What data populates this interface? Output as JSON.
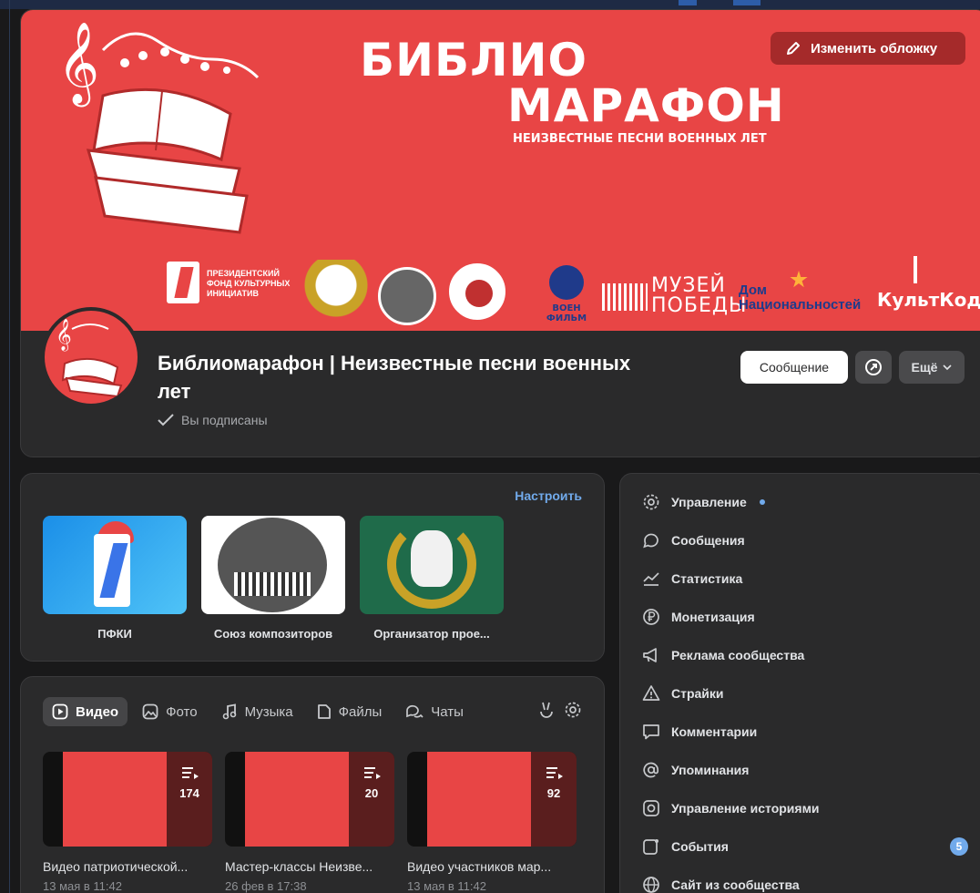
{
  "cover": {
    "title_line1": "БИБЛИО",
    "title_line2": "МАРАФОН",
    "subtitle": "НЕИЗВЕСТНЫЕ ПЕСНИ ВОЕННЫХ ЛЕТ",
    "edit_button": "Изменить обложку",
    "logos": {
      "pfki_text": "ПРЕЗИДЕНТСКИЙ ФОНД КУЛЬТУРНЫХ ИНИЦИАТИВ",
      "voen_text": "ВОЕН ФИЛЬМ",
      "muzey_text": "МУЗЕЙ ПОБЕДЫ",
      "dom_text": "Дом Национальностей",
      "kult_text": "КультКод"
    },
    "background_color": "#e84545"
  },
  "header": {
    "group_name": "Библиомарафон | Неизвестные песни военных лет",
    "subscribed_label": "Вы подписаны",
    "message_button": "Сообщение",
    "more_button": "Ещё"
  },
  "links": {
    "configure_label": "Настроить",
    "items": [
      {
        "label": "ПФКИ"
      },
      {
        "label": "Союз композиторов"
      },
      {
        "label": "Организатор прое..."
      }
    ]
  },
  "media": {
    "tabs": [
      {
        "label": "Видео",
        "icon": "video-icon",
        "active": true
      },
      {
        "label": "Фото",
        "icon": "photo-icon",
        "active": false
      },
      {
        "label": "Музыка",
        "icon": "music-icon",
        "active": false
      },
      {
        "label": "Файлы",
        "icon": "file-icon",
        "active": false
      },
      {
        "label": "Чаты",
        "icon": "chats-icon",
        "active": false
      }
    ],
    "videos": [
      {
        "count": "174",
        "title": "Видео патриотической...",
        "date": "13 мая в 11:42"
      },
      {
        "count": "20",
        "title": "Мастер-классы Неизве...",
        "date": "26 фев в 17:38"
      },
      {
        "count": "92",
        "title": "Видео участников мар...",
        "date": "13 мая в 11:42"
      }
    ]
  },
  "menu": {
    "items": [
      {
        "label": "Управление",
        "icon": "gear-icon"
      },
      {
        "label": "Сообщения",
        "icon": "message-icon"
      },
      {
        "label": "Статистика",
        "icon": "chart-icon"
      },
      {
        "label": "Монетизация",
        "icon": "ruble-icon"
      },
      {
        "label": "Реклама сообщества",
        "icon": "megaphone-icon"
      },
      {
        "label": "Страйки",
        "icon": "warning-icon"
      },
      {
        "label": "Комментарии",
        "icon": "comment-icon"
      },
      {
        "label": "Упоминания",
        "icon": "at-icon"
      },
      {
        "label": "Управление историями",
        "icon": "stories-icon"
      },
      {
        "label": "События",
        "icon": "events-icon",
        "badge": "5"
      },
      {
        "label": "Сайт из сообщества",
        "icon": "globe-icon"
      }
    ]
  },
  "colors": {
    "accent": "#71aaeb",
    "card": "#2a2a2b",
    "page": "#19191a"
  }
}
